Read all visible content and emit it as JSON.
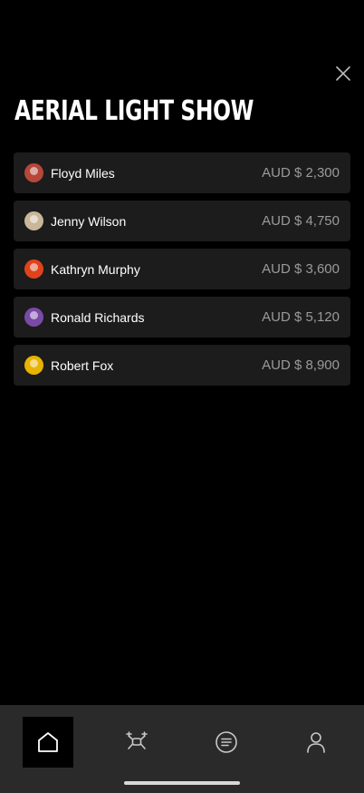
{
  "header": {
    "title": "AERIAL LIGHT SHOW",
    "close_icon": "close-icon"
  },
  "entries": [
    {
      "name": "Floyd Miles",
      "amount": "AUD $ 2,300",
      "avatar_color": "#b5483a"
    },
    {
      "name": "Jenny Wilson",
      "amount": "AUD $ 4,750",
      "avatar_color": "#c9b79a"
    },
    {
      "name": "Kathryn Murphy",
      "amount": "AUD $ 3,600",
      "avatar_color": "#e0431c"
    },
    {
      "name": "Ronald Richards",
      "amount": "AUD $ 5,120",
      "avatar_color": "#7a4aa8"
    },
    {
      "name": "Robert Fox",
      "amount": "AUD $ 8,900",
      "avatar_color": "#e8b400"
    }
  ],
  "tabbar": {
    "tabs": [
      {
        "name": "home",
        "icon": "home-icon",
        "active": true
      },
      {
        "name": "drone",
        "icon": "drone-icon",
        "active": false
      },
      {
        "name": "list",
        "icon": "list-icon",
        "active": false
      },
      {
        "name": "profile",
        "icon": "user-icon",
        "active": false
      }
    ]
  },
  "colors": {
    "background": "#000000",
    "row_background": "#1c1c1c",
    "tabbar_background": "#2a2a2a",
    "amount_text": "#9a9a9a",
    "icon": "#c8c8c8"
  }
}
